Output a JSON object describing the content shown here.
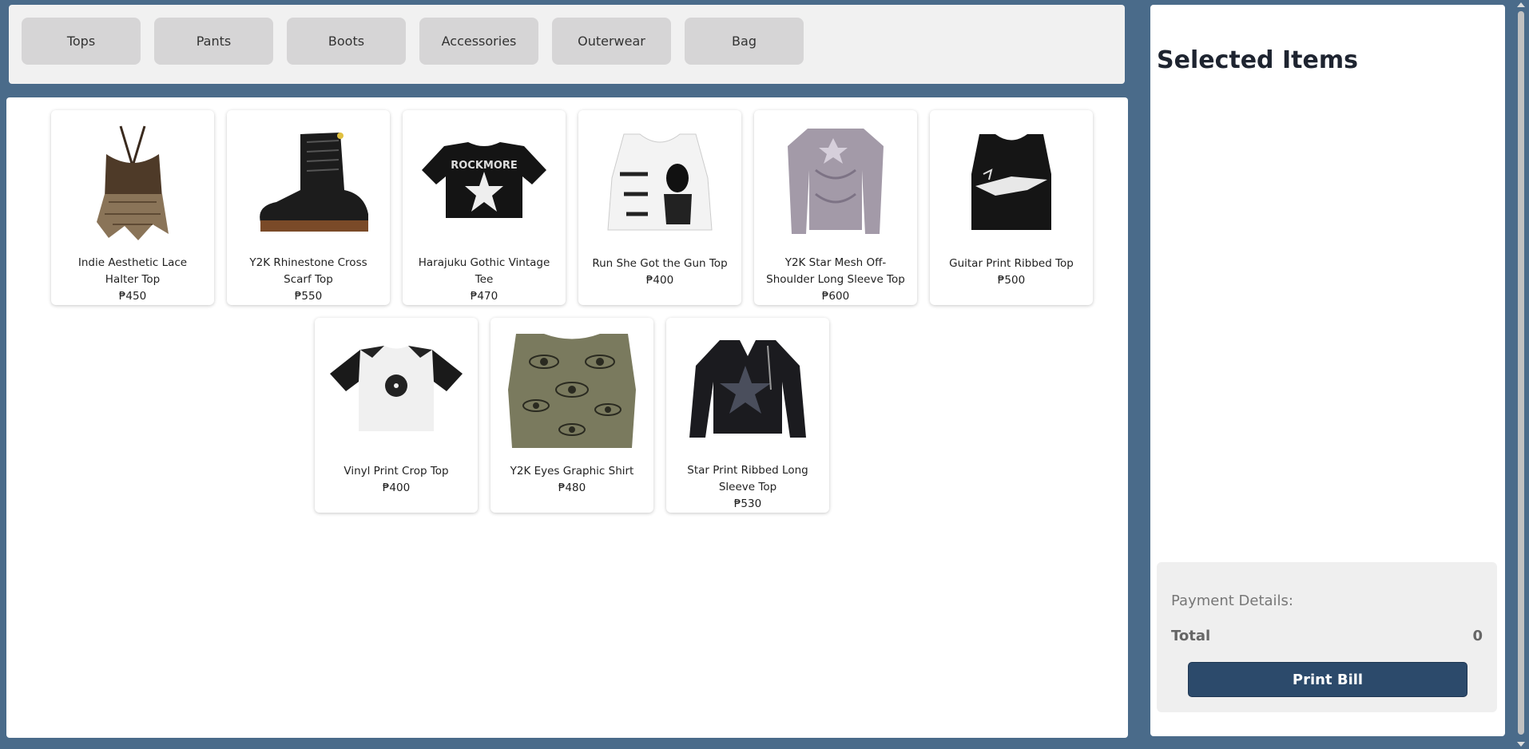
{
  "categories": [
    "Tops",
    "Pants",
    "Boots",
    "Accessories",
    "Outerwear",
    "Bag"
  ],
  "products": [
    {
      "name": "Indie Aesthetic Lace Halter Top",
      "price": "₱450",
      "image_icon": "lace-halter-top-image"
    },
    {
      "name": "Y2K Rhinestone Cross Scarf Top",
      "price": "₱550",
      "image_icon": "black-boot-image"
    },
    {
      "name": "Harajuku Gothic Vintage Tee",
      "price": "₱470",
      "image_icon": "rockmore-tee-image",
      "image_text": "ROCKMORE"
    },
    {
      "name": "Run She Got the Gun Top",
      "price": "₱400",
      "image_icon": "gun-print-tank-image"
    },
    {
      "name": "Y2K Star Mesh Off-Shoulder Long Sleeve Top",
      "price": "₱600",
      "image_icon": "mesh-long-sleeve-image"
    },
    {
      "name": "Guitar Print Ribbed Top",
      "price": "₱500",
      "image_icon": "guitar-print-top-image"
    },
    {
      "name": "Vinyl Print Crop Top",
      "price": "₱400",
      "image_icon": "vinyl-crop-top-image"
    },
    {
      "name": "Y2K Eyes Graphic Shirt",
      "price": "₱480",
      "image_icon": "eyes-graphic-top-image"
    },
    {
      "name": "Star Print Ribbed Long Sleeve Top",
      "price": "₱530",
      "image_icon": "star-sweater-image"
    }
  ],
  "cart": {
    "title": "Selected Items",
    "payment_label": "Payment Details:",
    "total_label": "Total",
    "total_value": "0",
    "print_label": "Print Bill"
  },
  "colors": {
    "page_bg": "#4a6b8a",
    "button_bg": "#d6d5d6",
    "print_button": "#2c4a6b"
  }
}
